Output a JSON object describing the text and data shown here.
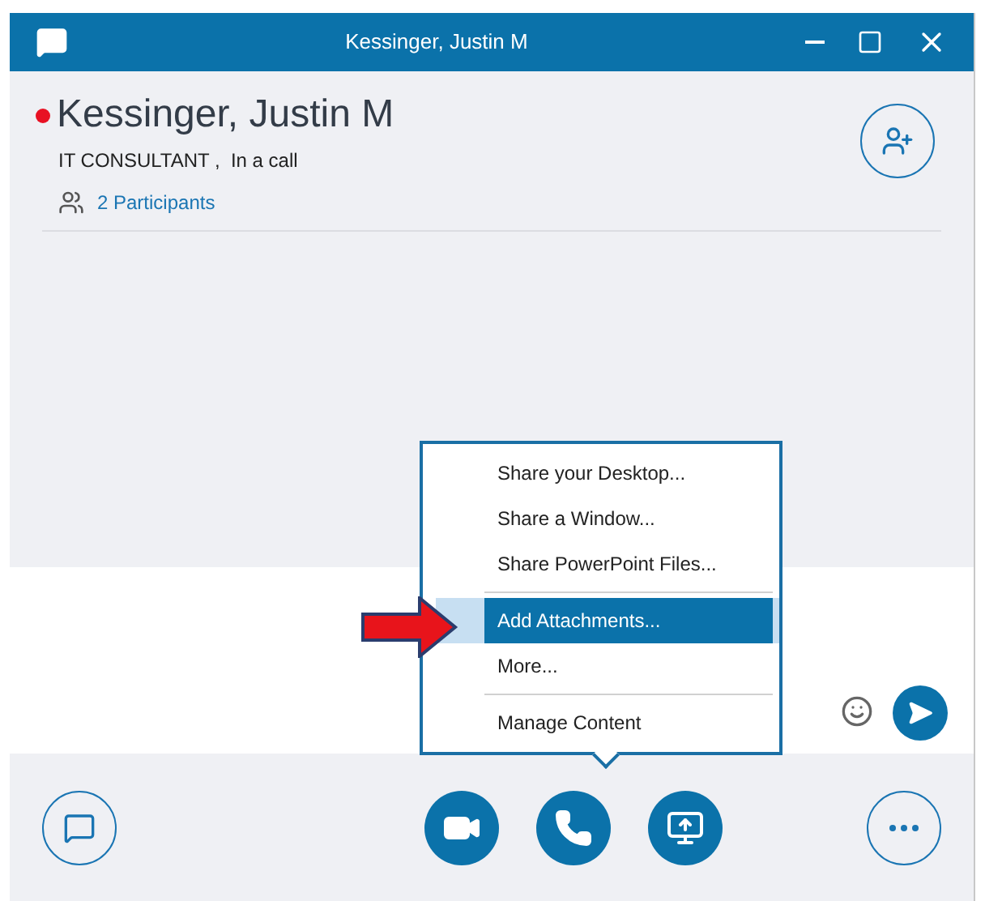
{
  "window": {
    "title": "Kessinger, Justin M"
  },
  "contact": {
    "name": "Kessinger, Justin M",
    "status": "IT CONSULTANT ,  In a call",
    "participants": "2 Participants"
  },
  "share_menu": {
    "items": [
      {
        "label": "Share your Desktop...",
        "selected": false,
        "separator_before": false
      },
      {
        "label": "Share a Window...",
        "selected": false,
        "separator_before": false
      },
      {
        "label": "Share PowerPoint Files...",
        "selected": false,
        "separator_before": false
      },
      {
        "label": "Add Attachments...",
        "selected": true,
        "separator_before": true
      },
      {
        "label": "More...",
        "selected": false,
        "separator_before": false
      },
      {
        "label": "Manage Content",
        "selected": false,
        "separator_before": true
      }
    ]
  },
  "toolbar": [
    {
      "kind": "video"
    },
    {
      "kind": "phone"
    },
    {
      "kind": "share"
    }
  ]
}
